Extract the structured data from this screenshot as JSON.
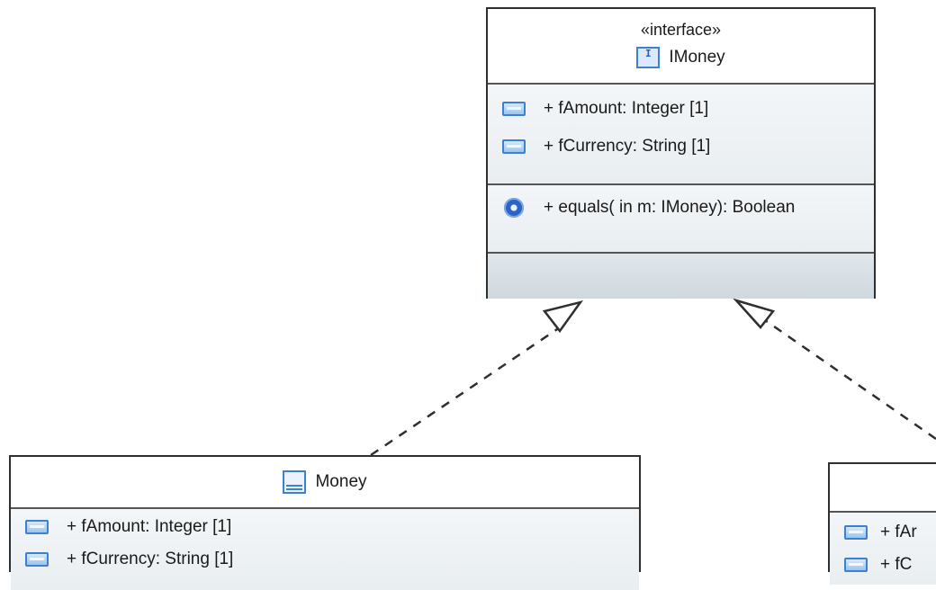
{
  "diagram": {
    "interface": {
      "stereotype": "«interface»",
      "icon": "interface-icon",
      "name": "IMoney",
      "attributes": [
        {
          "icon": "attribute-icon",
          "text": "+ fAmount: Integer [1]"
        },
        {
          "icon": "attribute-icon",
          "text": "+ fCurrency: String [1]"
        }
      ],
      "operations": [
        {
          "icon": "operation-gear-icon",
          "text": "+ equals(  in m: IMoney): Boolean"
        }
      ]
    },
    "money_class": {
      "icon": "class-icon",
      "name": "Money",
      "attributes": [
        {
          "icon": "attribute-icon",
          "text": "+ fAmount: Integer [1]"
        },
        {
          "icon": "attribute-icon",
          "text": "+ fCurrency: String [1]"
        }
      ]
    },
    "right_class": {
      "attributes": [
        {
          "icon": "attribute-icon",
          "text": "+ fAr"
        },
        {
          "icon": "attribute-icon",
          "text": "+ fC"
        }
      ]
    },
    "relations": [
      {
        "type": "realization",
        "from": "Money",
        "to": "IMoney"
      },
      {
        "type": "realization",
        "from": "right_class",
        "to": "IMoney"
      }
    ]
  }
}
